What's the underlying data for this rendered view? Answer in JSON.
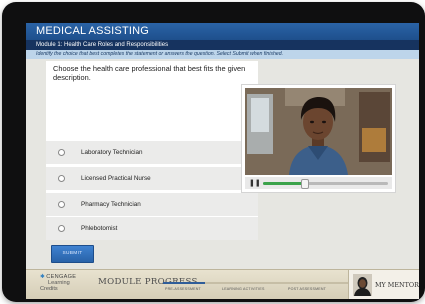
{
  "app": {
    "title": "MEDICAL ASSISTING",
    "module": "Module 1: Health Care Roles and Responsibilities",
    "instructions": "Identify the choice that best completes the statement or answers the question. Select Submit when finished."
  },
  "question": {
    "prompt": "Choose the health care professional that best fits the given description.",
    "choices": [
      "Laboratory Technician",
      "Licensed Practical Nurse",
      "Pharmacy Technician",
      "Phlebotomist"
    ],
    "submit_label": "SUBMIT"
  },
  "video": {
    "control_icon": "pause-icon",
    "progress_fraction": 0.33
  },
  "footer": {
    "logo_line1": "CENGAGE",
    "logo_line2": "Learning",
    "logo_line3": "Credits",
    "progress_label": "MODULE PROGRESS",
    "progress_fraction": 0.22,
    "stages": [
      "PRE-ASSESSMENT",
      "LEARNING ACTIVITIES",
      "POST ASSESSMENT"
    ],
    "mentor_label": "MY MENTOR"
  },
  "colors": {
    "title_bar": "#2a63a6",
    "module_bar": "#16335f",
    "instruction_bar": "#bdd5ea",
    "accent_green": "#3ba34b",
    "submit_button": "#3f82d0"
  }
}
